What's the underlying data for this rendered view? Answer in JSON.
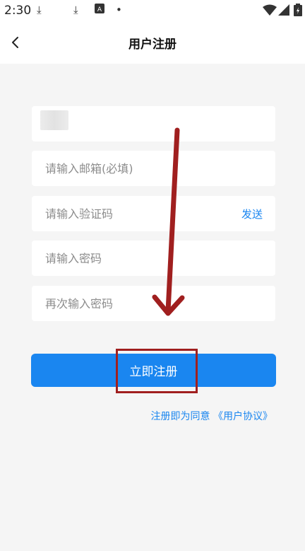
{
  "status_bar": {
    "time": "2:30",
    "icons": [
      "download-icon",
      "download-icon",
      "app-notification-icon",
      "dot-icon",
      "wifi-icon",
      "signal-icon",
      "battery-icon"
    ]
  },
  "header": {
    "title": "用户注册",
    "back_icon": "chevron-left-icon"
  },
  "form": {
    "username_value": "",
    "email_placeholder": "请输入邮箱(必填)",
    "code_placeholder": "请输入验证码",
    "send_label": "发送",
    "password_placeholder": "请输入密码",
    "confirm_placeholder": "再次输入密码"
  },
  "register_label": "立即注册",
  "agreement_text": "注册即为同意 《用户协议》",
  "colors": {
    "accent": "#1a86f0",
    "annotation": "#a01f1f",
    "background": "#f5f5f5"
  }
}
